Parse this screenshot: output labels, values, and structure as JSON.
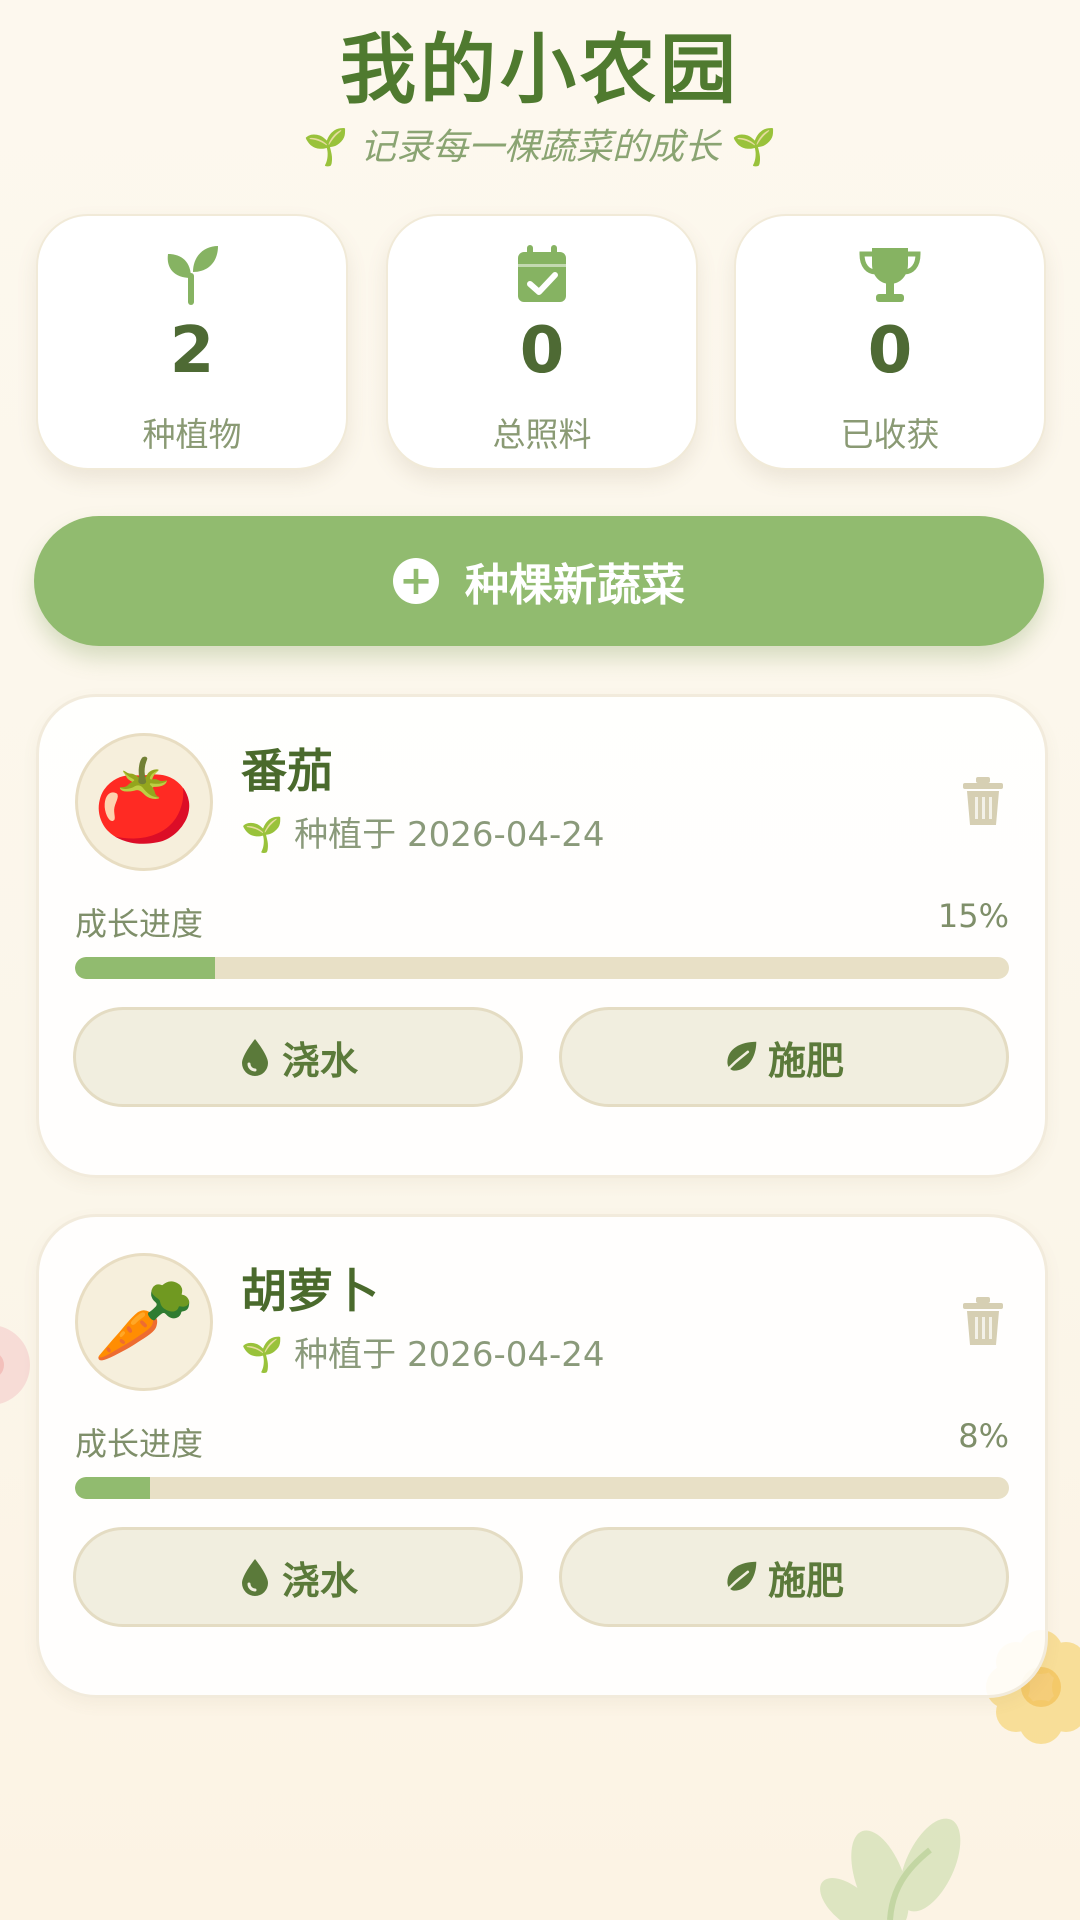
{
  "header": {
    "title": "我的小农园",
    "subtitle": "记录每一棵蔬菜的成长",
    "subtitle_icon": "🌱"
  },
  "stats": [
    {
      "icon": "sprout-icon",
      "value": "2",
      "label": "种植物"
    },
    {
      "icon": "calendar-check-icon",
      "value": "0",
      "label": "总照料"
    },
    {
      "icon": "trophy-icon",
      "value": "0",
      "label": "已收获"
    }
  ],
  "add_button": {
    "label": "种棵新蔬菜",
    "icon": "plus-circle-icon"
  },
  "plants": [
    {
      "name": "番茄",
      "emoji": "🍅",
      "planted_icon": "🌱",
      "planted_text": "种植于 2026-04-24",
      "progress_label": "成长进度",
      "progress_pct_text": "15%",
      "progress": 0.15,
      "water_label": "浇水",
      "fertilize_label": "施肥"
    },
    {
      "name": "胡萝卜",
      "emoji": "🥕",
      "planted_icon": "🌱",
      "planted_text": "种植于 2026-04-24",
      "progress_label": "成长进度",
      "progress_pct_text": "8%",
      "progress": 0.08,
      "water_label": "浇水",
      "fertilize_label": "施肥"
    }
  ],
  "colors": {
    "accent": "#91bb6f",
    "title": "#4f7a2f",
    "track": "#e8e0c6"
  }
}
